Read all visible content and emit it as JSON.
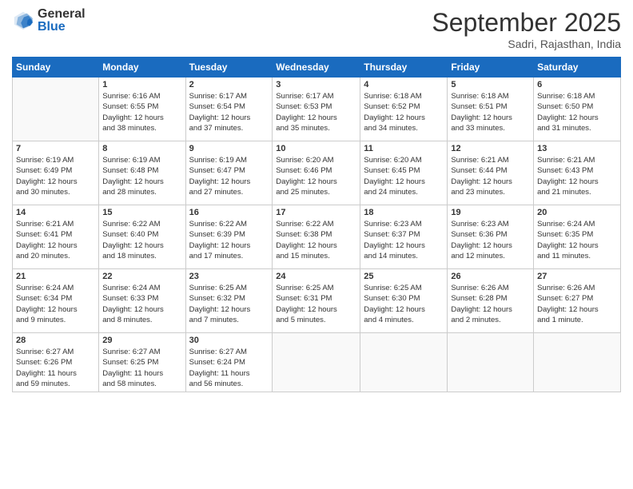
{
  "logo": {
    "general": "General",
    "blue": "Blue"
  },
  "header": {
    "month": "September 2025",
    "location": "Sadri, Rajasthan, India"
  },
  "weekdays": [
    "Sunday",
    "Monday",
    "Tuesday",
    "Wednesday",
    "Thursday",
    "Friday",
    "Saturday"
  ],
  "weeks": [
    [
      {
        "day": "",
        "info": ""
      },
      {
        "day": "1",
        "info": "Sunrise: 6:16 AM\nSunset: 6:55 PM\nDaylight: 12 hours\nand 38 minutes."
      },
      {
        "day": "2",
        "info": "Sunrise: 6:17 AM\nSunset: 6:54 PM\nDaylight: 12 hours\nand 37 minutes."
      },
      {
        "day": "3",
        "info": "Sunrise: 6:17 AM\nSunset: 6:53 PM\nDaylight: 12 hours\nand 35 minutes."
      },
      {
        "day": "4",
        "info": "Sunrise: 6:18 AM\nSunset: 6:52 PM\nDaylight: 12 hours\nand 34 minutes."
      },
      {
        "day": "5",
        "info": "Sunrise: 6:18 AM\nSunset: 6:51 PM\nDaylight: 12 hours\nand 33 minutes."
      },
      {
        "day": "6",
        "info": "Sunrise: 6:18 AM\nSunset: 6:50 PM\nDaylight: 12 hours\nand 31 minutes."
      }
    ],
    [
      {
        "day": "7",
        "info": "Sunrise: 6:19 AM\nSunset: 6:49 PM\nDaylight: 12 hours\nand 30 minutes."
      },
      {
        "day": "8",
        "info": "Sunrise: 6:19 AM\nSunset: 6:48 PM\nDaylight: 12 hours\nand 28 minutes."
      },
      {
        "day": "9",
        "info": "Sunrise: 6:19 AM\nSunset: 6:47 PM\nDaylight: 12 hours\nand 27 minutes."
      },
      {
        "day": "10",
        "info": "Sunrise: 6:20 AM\nSunset: 6:46 PM\nDaylight: 12 hours\nand 25 minutes."
      },
      {
        "day": "11",
        "info": "Sunrise: 6:20 AM\nSunset: 6:45 PM\nDaylight: 12 hours\nand 24 minutes."
      },
      {
        "day": "12",
        "info": "Sunrise: 6:21 AM\nSunset: 6:44 PM\nDaylight: 12 hours\nand 23 minutes."
      },
      {
        "day": "13",
        "info": "Sunrise: 6:21 AM\nSunset: 6:43 PM\nDaylight: 12 hours\nand 21 minutes."
      }
    ],
    [
      {
        "day": "14",
        "info": "Sunrise: 6:21 AM\nSunset: 6:41 PM\nDaylight: 12 hours\nand 20 minutes."
      },
      {
        "day": "15",
        "info": "Sunrise: 6:22 AM\nSunset: 6:40 PM\nDaylight: 12 hours\nand 18 minutes."
      },
      {
        "day": "16",
        "info": "Sunrise: 6:22 AM\nSunset: 6:39 PM\nDaylight: 12 hours\nand 17 minutes."
      },
      {
        "day": "17",
        "info": "Sunrise: 6:22 AM\nSunset: 6:38 PM\nDaylight: 12 hours\nand 15 minutes."
      },
      {
        "day": "18",
        "info": "Sunrise: 6:23 AM\nSunset: 6:37 PM\nDaylight: 12 hours\nand 14 minutes."
      },
      {
        "day": "19",
        "info": "Sunrise: 6:23 AM\nSunset: 6:36 PM\nDaylight: 12 hours\nand 12 minutes."
      },
      {
        "day": "20",
        "info": "Sunrise: 6:24 AM\nSunset: 6:35 PM\nDaylight: 12 hours\nand 11 minutes."
      }
    ],
    [
      {
        "day": "21",
        "info": "Sunrise: 6:24 AM\nSunset: 6:34 PM\nDaylight: 12 hours\nand 9 minutes."
      },
      {
        "day": "22",
        "info": "Sunrise: 6:24 AM\nSunset: 6:33 PM\nDaylight: 12 hours\nand 8 minutes."
      },
      {
        "day": "23",
        "info": "Sunrise: 6:25 AM\nSunset: 6:32 PM\nDaylight: 12 hours\nand 7 minutes."
      },
      {
        "day": "24",
        "info": "Sunrise: 6:25 AM\nSunset: 6:31 PM\nDaylight: 12 hours\nand 5 minutes."
      },
      {
        "day": "25",
        "info": "Sunrise: 6:25 AM\nSunset: 6:30 PM\nDaylight: 12 hours\nand 4 minutes."
      },
      {
        "day": "26",
        "info": "Sunrise: 6:26 AM\nSunset: 6:28 PM\nDaylight: 12 hours\nand 2 minutes."
      },
      {
        "day": "27",
        "info": "Sunrise: 6:26 AM\nSunset: 6:27 PM\nDaylight: 12 hours\nand 1 minute."
      }
    ],
    [
      {
        "day": "28",
        "info": "Sunrise: 6:27 AM\nSunset: 6:26 PM\nDaylight: 11 hours\nand 59 minutes."
      },
      {
        "day": "29",
        "info": "Sunrise: 6:27 AM\nSunset: 6:25 PM\nDaylight: 11 hours\nand 58 minutes."
      },
      {
        "day": "30",
        "info": "Sunrise: 6:27 AM\nSunset: 6:24 PM\nDaylight: 11 hours\nand 56 minutes."
      },
      {
        "day": "",
        "info": ""
      },
      {
        "day": "",
        "info": ""
      },
      {
        "day": "",
        "info": ""
      },
      {
        "day": "",
        "info": ""
      }
    ]
  ]
}
